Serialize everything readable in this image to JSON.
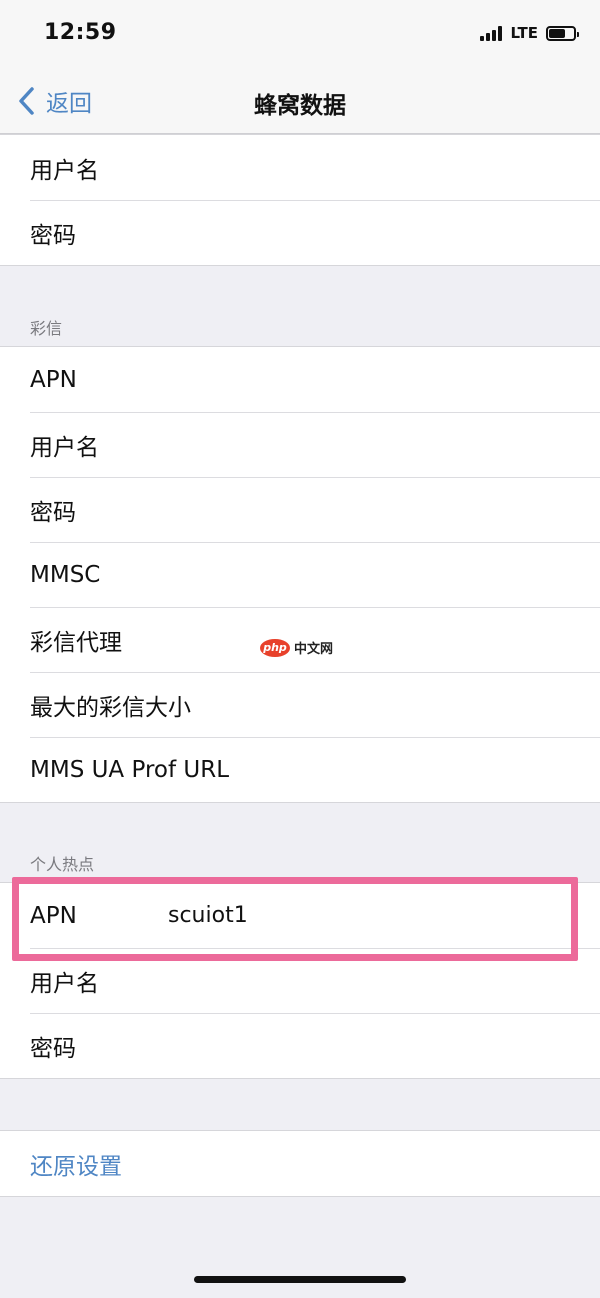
{
  "status_bar": {
    "time": "12:59",
    "network": "LTE"
  },
  "nav": {
    "back_label": "返回",
    "title": "蜂窝数据"
  },
  "group_top": {
    "rows": [
      {
        "label": "用户名",
        "value": ""
      },
      {
        "label": "密码",
        "value": ""
      }
    ]
  },
  "mms": {
    "header": "彩信",
    "rows": [
      {
        "label": "APN",
        "value": ""
      },
      {
        "label": "用户名",
        "value": ""
      },
      {
        "label": "密码",
        "value": ""
      },
      {
        "label": "MMSC",
        "value": ""
      },
      {
        "label": "彩信代理",
        "value": ""
      },
      {
        "label": "最大的彩信大小",
        "value": ""
      },
      {
        "label": "MMS UA Prof URL",
        "value": ""
      }
    ]
  },
  "hotspot": {
    "header": "个人热点",
    "rows": [
      {
        "label": "APN",
        "value": "scuiot1"
      },
      {
        "label": "用户名",
        "value": ""
      },
      {
        "label": "密码",
        "value": ""
      }
    ]
  },
  "reset": {
    "label": "还原设置"
  },
  "watermark": {
    "logo": "php",
    "text": "中文网"
  },
  "colors": {
    "accent": "#4f86c4",
    "highlight": "#ec6a9a",
    "background": "#efeff4"
  },
  "icons": {
    "back": "chevron-left-icon",
    "signal": "cellular-signal-icon",
    "battery": "battery-icon"
  }
}
